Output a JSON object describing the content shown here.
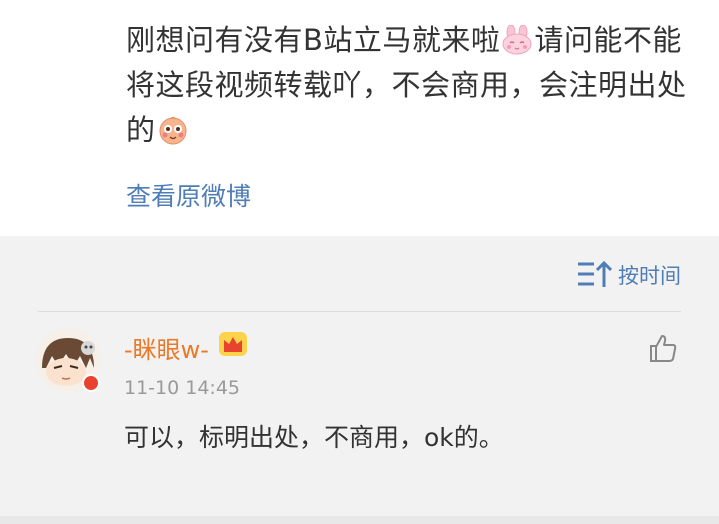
{
  "post": {
    "text_part1": "刚想问有没有B站立马就来啦",
    "text_part2": "请问能不能将这段视频转载吖，不会商用，会注明出处的",
    "emoji1": "rabbit-emoji",
    "emoji2": "shy-face-emoji",
    "view_original": "查看原微博"
  },
  "comments": {
    "sort_label": "按时间",
    "items": [
      {
        "username": "-眯眼w-",
        "timestamp": "11-10 14:45",
        "text": "可以，标明出处，不商用，ok的。"
      }
    ]
  },
  "colors": {
    "link": "#4f7db5",
    "username": "#ea7a2a",
    "text": "#333333",
    "muted": "#9a9a9a",
    "panel_bg": "#f2f2f2"
  }
}
